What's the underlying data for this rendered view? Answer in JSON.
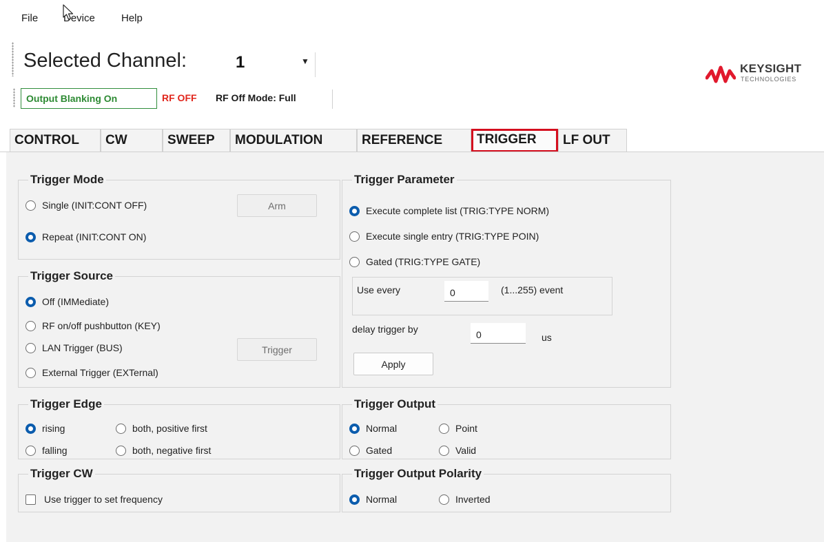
{
  "menu": {
    "file": "File",
    "device": "Device",
    "help": "Help"
  },
  "header": {
    "selected_channel_label": "Selected Channel:",
    "selected_channel_value": "1",
    "status": {
      "blanking": "Output Blanking On",
      "rf": "RF OFF",
      "rf_off_mode": "RF Off Mode: Full"
    },
    "logo": {
      "name": "KEYSIGHT",
      "sub": "TECHNOLOGIES"
    }
  },
  "tabs": [
    {
      "label": "CONTROL"
    },
    {
      "label": "CW"
    },
    {
      "label": "SWEEP"
    },
    {
      "label": "MODULATION"
    },
    {
      "label": "REFERENCE"
    },
    {
      "label": "TRIGGER",
      "active": true
    },
    {
      "label": "LF OUT"
    }
  ],
  "trigger_mode": {
    "title": "Trigger Mode",
    "single": "Single (INIT:CONT OFF)",
    "repeat": "Repeat (INIT:CONT ON)",
    "selected": "repeat",
    "arm_button": "Arm"
  },
  "trigger_source": {
    "title": "Trigger Source",
    "off": "Off (IMMediate)",
    "rf_key": "RF on/off pushbutton (KEY)",
    "lan": "LAN Trigger (BUS)",
    "external": "External Trigger (EXTernal)",
    "selected": "off",
    "trigger_button": "Trigger"
  },
  "trigger_edge": {
    "title": "Trigger Edge",
    "rising": "rising",
    "falling": "falling",
    "both_pos": "both, positive first",
    "both_neg": "both, negative first",
    "selected": "rising"
  },
  "trigger_cw": {
    "title": "Trigger CW",
    "use_trigger": "Use trigger to set frequency",
    "checked": false
  },
  "trigger_parameter": {
    "title": "Trigger Parameter",
    "complete_list": "Execute complete list (TRIG:TYPE NORM)",
    "single_entry": "Execute single entry (TRIG:TYPE POIN)",
    "gated": "Gated (TRIG:TYPE GATE)",
    "selected": "complete_list",
    "use_every_label": "Use every",
    "use_every_value": "0",
    "use_every_suffix": "(1...255) event",
    "delay_label": "delay trigger by",
    "delay_value": "0",
    "delay_unit": "us",
    "apply_button": "Apply"
  },
  "trigger_output": {
    "title": "Trigger Output",
    "normal": "Normal",
    "point": "Point",
    "gated": "Gated",
    "valid": "Valid",
    "selected": "normal"
  },
  "trigger_output_polarity": {
    "title": "Trigger Output Polarity",
    "normal": "Normal",
    "inverted": "Inverted",
    "selected": "normal"
  },
  "colors": {
    "tab_highlight": "#d40f1f",
    "radio_selected": "#0b5cad",
    "blanking_green": "#2d8a33",
    "rf_off_red": "#e1251b",
    "logo_red": "#e1192d"
  }
}
